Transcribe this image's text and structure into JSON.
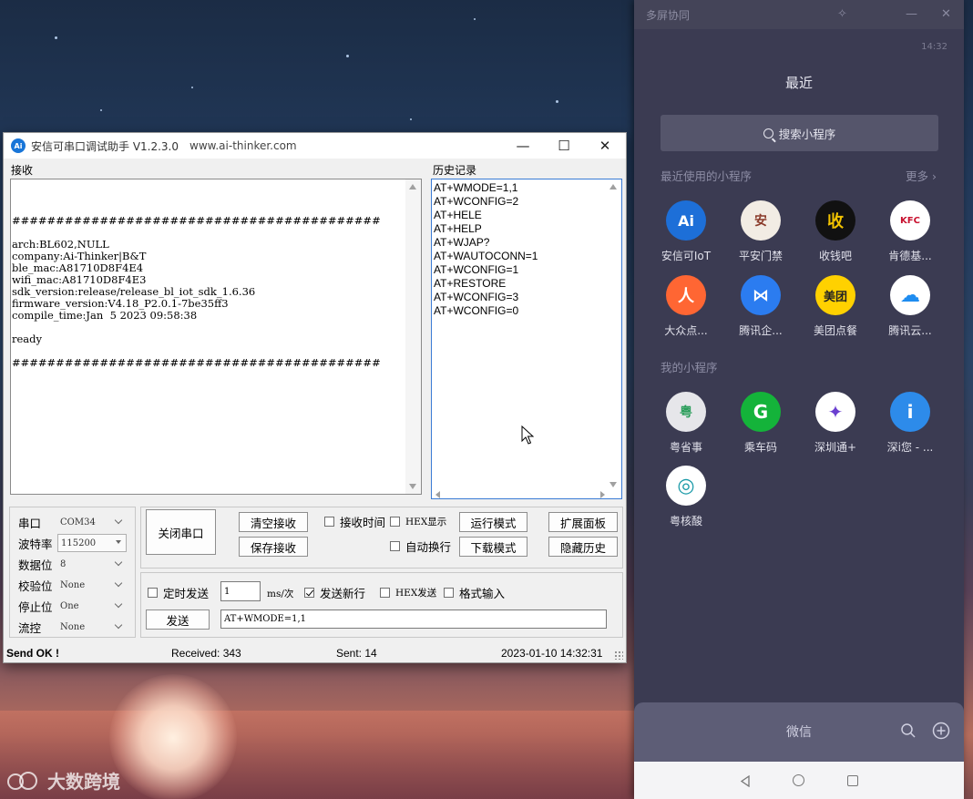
{
  "serial_tool": {
    "title": "安信可串口调试助手 V1.2.3.0",
    "url": "www.ai-thinker.com",
    "window_controls": {
      "minimize": "—",
      "maximize": "☐",
      "close": "✕"
    },
    "receive_label": "接收",
    "receive_text": "\n##########################################\n\narch:BL602,NULL\ncompany:Ai-Thinker|B&T\nble_mac:A81710D8F4E4\nwifi_mac:A81710D8F4E3\nsdk_version:release/release_bl_iot_sdk_1.6.36\nfirmware_version:V4.18_P2.0.1-7be35ff3\ncompile_time:Jan  5 2023 09:58:38\n\nready\n\n##########################################",
    "history_label": "历史记录",
    "history_items": [
      "AT+WMODE=1,1",
      "AT+WCONFIG=2",
      "AT+HELE",
      "AT+HELP",
      "AT+WJAP?",
      "AT+WAUTOCONN=1",
      "AT+WCONFIG=1",
      "AT+RESTORE",
      "AT+WCONFIG=3",
      "AT+WCONFIG=0"
    ],
    "port_settings": [
      {
        "label": "串口",
        "value": "COM34"
      },
      {
        "label": "波特率",
        "value": "115200"
      },
      {
        "label": "数据位",
        "value": "8"
      },
      {
        "label": "校验位",
        "value": "None"
      },
      {
        "label": "停止位",
        "value": "One"
      },
      {
        "label": "流控",
        "value": "None"
      }
    ],
    "buttons": {
      "close_port": "关闭串口",
      "clear_recv": "清空接收",
      "save_recv": "保存接收",
      "run_mode": "运行模式",
      "download_mode": "下载模式",
      "expand_panel": "扩展面板",
      "hide_history": "隐藏历史",
      "send": "发送"
    },
    "checkboxes": {
      "recv_time": {
        "label": "接收时间",
        "checked": false
      },
      "hex_display": {
        "label": "HEX显示",
        "checked": false
      },
      "auto_wrap": {
        "label": "自动换行",
        "checked": false
      },
      "timed_send": {
        "label": "定时发送",
        "checked": false
      },
      "send_newline": {
        "label": "发送新行",
        "checked": true
      },
      "hex_send": {
        "label": "HEX发送",
        "checked": false
      },
      "format_input": {
        "label": "格式输入",
        "checked": false
      }
    },
    "interval_value": "1",
    "interval_unit": "ms/次",
    "send_input_value": "AT+WMODE=1,1",
    "status": {
      "send_state": "Send OK !",
      "received": "Received: 343",
      "sent": "Sent: 14",
      "datetime": "2023-01-10 14:32:31"
    }
  },
  "phone": {
    "window_title": "多屏协同",
    "status_time": "14:32",
    "heading": "最近",
    "search_placeholder": "搜索小程序",
    "recent_section": "最近使用的小程序",
    "more": "更多 ›",
    "recent_apps": [
      {
        "label": "安信可IoT",
        "icon": "Ai",
        "bg": "#1d6fd8",
        "fg": "#ffffff"
      },
      {
        "label": "平安门禁",
        "icon": "安",
        "bg": "#f2ece4",
        "fg": "#8a3a2a"
      },
      {
        "label": "收钱吧",
        "icon": "收",
        "bg": "#111111",
        "fg": "#f2c300"
      },
      {
        "label": "肯德基...",
        "icon": "KFC",
        "bg": "#ffffff",
        "fg": "#c8102e"
      },
      {
        "label": "大众点...",
        "icon": "人",
        "bg": "#ff6633",
        "fg": "#ffffff"
      },
      {
        "label": "腾讯企...",
        "icon": "⋈",
        "bg": "#2b7cf0",
        "fg": "#ffffff"
      },
      {
        "label": "美团点餐",
        "icon": "美团",
        "bg": "#ffd100",
        "fg": "#222222"
      },
      {
        "label": "腾讯云...",
        "icon": "☁",
        "bg": "#ffffff",
        "fg": "#1e8cf0"
      }
    ],
    "my_section": "我的小程序",
    "my_apps": [
      {
        "label": "粤省事",
        "icon": "粤",
        "bg": "#e6e6ea",
        "fg": "#2a9d5a"
      },
      {
        "label": "乘车码",
        "icon": "G",
        "bg": "#14b33a",
        "fg": "#ffffff"
      },
      {
        "label": "深圳通+",
        "icon": "✦",
        "bg": "#ffffff",
        "fg": "#6a3fd0"
      },
      {
        "label": "深i您 - ...",
        "icon": "i",
        "bg": "#2d8bea",
        "fg": "#ffffff"
      },
      {
        "label": "粤核酸",
        "icon": "◎",
        "bg": "#ffffff",
        "fg": "#1a9aa8"
      }
    ],
    "bottom_title": "微信"
  },
  "watermark": "大数跨境",
  "colors": {
    "accent": "#3a7bd5",
    "phone_bg": "#3b3b52",
    "phone_bottom": "#5d5d76"
  }
}
